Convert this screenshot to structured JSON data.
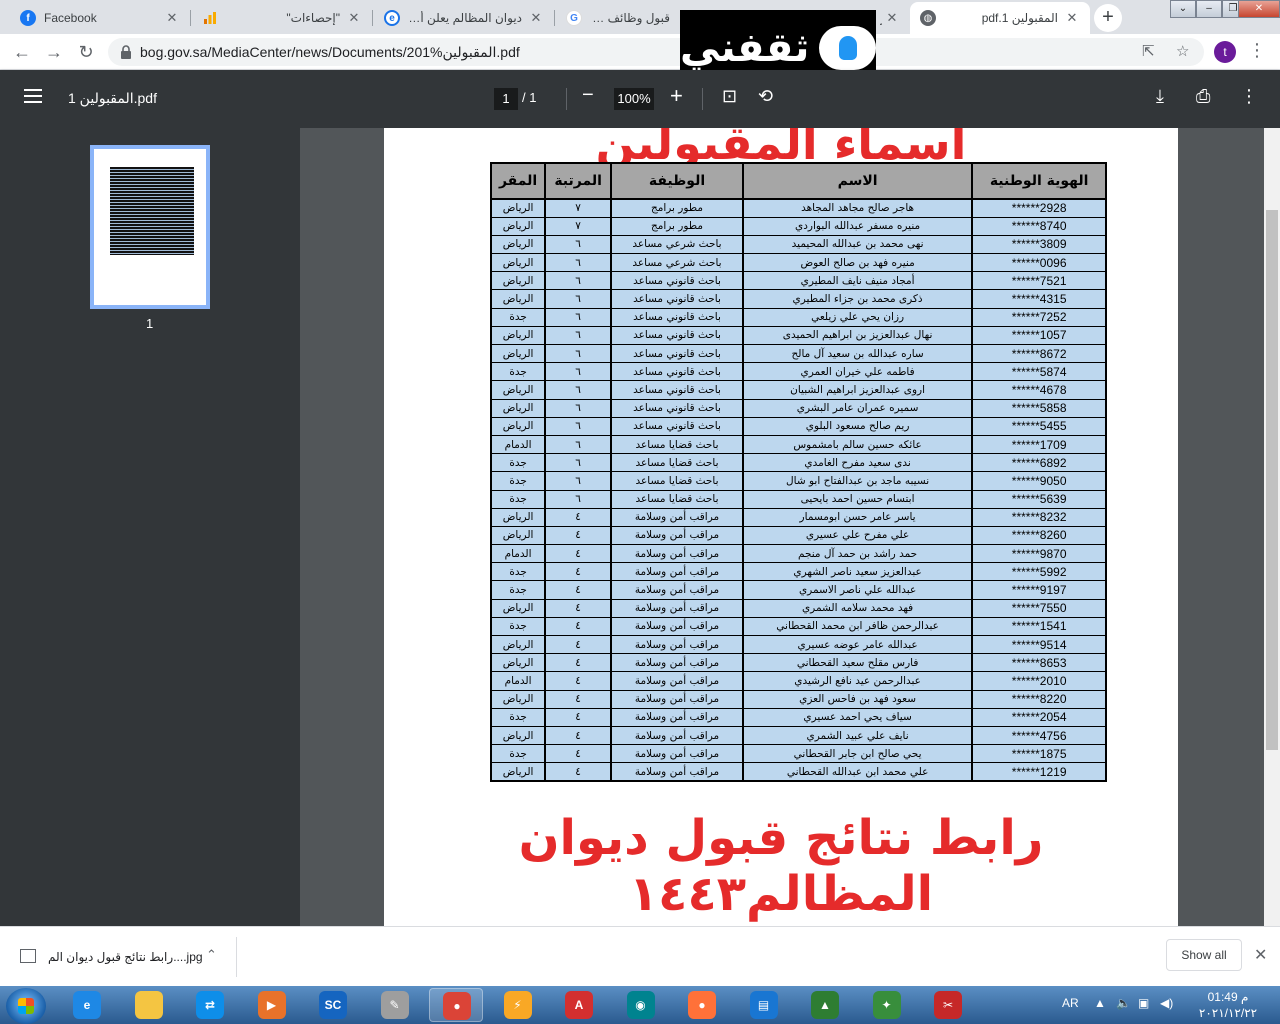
{
  "tabs": [
    {
      "title": "Facebook",
      "icon": "facebook-icon",
      "color": "#1877f2"
    },
    {
      "title": "\"إحصاءات\"",
      "icon": "analytics-icon",
      "color": "#f9ab00"
    },
    {
      "title": "ديوان المظالم يعلن أسماء المقـ",
      "icon": "site-icon",
      "color": "#1a73e8"
    },
    {
      "title": "قبول وظائف ديوان المظ",
      "icon": "google-icon",
      "color": "#4285f4"
    },
    {
      "title": "ر",
      "icon": "site-icon",
      "color": "#9aa0a6"
    },
    {
      "title": "المقبولين 1.pdf",
      "icon": "globe-icon",
      "color": "#5f6368"
    }
  ],
  "omnibox": {
    "url": "bog.gov.sa/MediaCenter/news/Documents/201%المقبولين.pdf"
  },
  "profile_initial": "t",
  "logo_text": "ثقفني",
  "pdf": {
    "title": "المقبولين 1.pdf",
    "page_current": "1",
    "page_total": "/   1",
    "zoom": "100%",
    "thumb_label": "1"
  },
  "document": {
    "heading": "أسماء المقبولين",
    "footer": "رابط نتائج قبول ديوان المظالم١٤٤٣",
    "columns": [
      "الهوية الوطنية",
      "الاسم",
      "الوظيفة",
      "المرتبة",
      "المقر"
    ],
    "rows": [
      [
        "******2928",
        "هاجر صالح مجاهد المجاهد",
        "مطور برامج",
        "٧",
        "الرياض"
      ],
      [
        "******8740",
        "منيره مسفر عبدالله البواردي",
        "مطور برامج",
        "٧",
        "الرياض"
      ],
      [
        "******3809",
        "نهى محمد بن عبدالله المحيميد",
        "باحث شرعي مساعد",
        "٦",
        "الرياض"
      ],
      [
        "******0096",
        "منيره فهد بن صالح العوض",
        "باحث شرعي مساعد",
        "٦",
        "الرياض"
      ],
      [
        "******7521",
        "أمجاد منيف نايف المطيري",
        "باحث قانوني مساعد",
        "٦",
        "الرياض"
      ],
      [
        "******4315",
        "ذكرى محمد بن جزاء المطيري",
        "باحث قانوني مساعد",
        "٦",
        "الرياض"
      ],
      [
        "******7252",
        "رزان يحي علي زيلعي",
        "باحث قانوني مساعد",
        "٦",
        "جدة"
      ],
      [
        "******1057",
        "نهال عبدالعزيز بن ابراهيم الحميدى",
        "باحث قانوني مساعد",
        "٦",
        "الرياض"
      ],
      [
        "******8672",
        "ساره عبدالله بن سعيد آل مالح",
        "باحث قانوني مساعد",
        "٦",
        "الرياض"
      ],
      [
        "******5874",
        "فاطمه علي خيران العمري",
        "باحث قانوني مساعد",
        "٦",
        "جدة"
      ],
      [
        "******4678",
        "اروى عبدالعزيز ابراهيم الشبيان",
        "باحث قانوني مساعد",
        "٦",
        "الرياض"
      ],
      [
        "******5858",
        "سميره عمران عامر البشري",
        "باحث قانوني مساعد",
        "٦",
        "الرياض"
      ],
      [
        "******5455",
        "ريم صالح مسعود البلوي",
        "باحث قانوني مساعد",
        "٦",
        "الرياض"
      ],
      [
        "******1709",
        "عائكه حسين سالم بامشموس",
        "باحث قضايا مساعد",
        "٦",
        "الدمام"
      ],
      [
        "******6892",
        "ندى سعيد مفرح الغامدي",
        "باحث قضايا مساعد",
        "٦",
        "جدة"
      ],
      [
        "******9050",
        "نسيبه ماجد بن عبدالفتاح ابو شال",
        "باحث قضايا مساعد",
        "٦",
        "جدة"
      ],
      [
        "******5639",
        "ابتسام حسين احمد بايحيى",
        "باحث قضايا مساعد",
        "٦",
        "جدة"
      ],
      [
        "******8232",
        "ياسر عامر حسن ابومسمار",
        "مراقب أمن وسلامة",
        "٤",
        "الرياض"
      ],
      [
        "******8260",
        "علي مفرح علي عسيري",
        "مراقب أمن وسلامة",
        "٤",
        "الرياض"
      ],
      [
        "******9870",
        "حمد راشد بن حمد آل منجم",
        "مراقب أمن وسلامة",
        "٤",
        "الدمام"
      ],
      [
        "******5992",
        "عبدالعزيز سعيد ناصر الشهري",
        "مراقب أمن وسلامة",
        "٤",
        "جدة"
      ],
      [
        "******9197",
        "عبدالله علي ناصر الاسمري",
        "مراقب أمن وسلامة",
        "٤",
        "جدة"
      ],
      [
        "******7550",
        "فهد محمد سلامه الشمري",
        "مراقب أمن وسلامة",
        "٤",
        "الرياض"
      ],
      [
        "******1541",
        "عبدالرحمن ظافر ابن محمد القحطاني",
        "مراقب أمن وسلامة",
        "٤",
        "جدة"
      ],
      [
        "******9514",
        "عبدالله عامر عوضه عسيري",
        "مراقب أمن وسلامة",
        "٤",
        "الرياض"
      ],
      [
        "******8653",
        "فارس مقلح سعيد القحطاني",
        "مراقب أمن وسلامة",
        "٤",
        "الرياض"
      ],
      [
        "******2010",
        "عبدالرحمن عيد نافع الرشيدي",
        "مراقب أمن وسلامة",
        "٤",
        "الدمام"
      ],
      [
        "******8220",
        "سعود فهد بن فاحس العزي",
        "مراقب أمن وسلامة",
        "٤",
        "الرياض"
      ],
      [
        "******2054",
        "سياف يحي احمد عسيري",
        "مراقب أمن وسلامة",
        "٤",
        "جدة"
      ],
      [
        "******4756",
        "نايف علي عبيد الشمري",
        "مراقب أمن وسلامة",
        "٤",
        "الرياض"
      ],
      [
        "******1875",
        "يحي صالح ابن جابر القحطاني",
        "مراقب أمن وسلامة",
        "٤",
        "جدة"
      ],
      [
        "******1219",
        "علي محمد ابن عبدالله القحطاني",
        "مراقب أمن وسلامة",
        "٤",
        "الرياض"
      ]
    ]
  },
  "download": {
    "filename": "رابط نتائج قبول ديوان الم....jpg",
    "show_all": "Show all"
  },
  "taskbar": {
    "apps": [
      {
        "name": "ie-icon",
        "color": "#1e88e5",
        "label": "e"
      },
      {
        "name": "file-explorer-icon",
        "color": "#f4c542",
        "label": ""
      },
      {
        "name": "teamviewer-icon",
        "color": "#0e8ee9",
        "label": "⇄"
      },
      {
        "name": "media-player-icon",
        "color": "#e8722a",
        "label": "▶"
      },
      {
        "name": "sc-app-icon",
        "color": "#1565c0",
        "label": "SC"
      },
      {
        "name": "notepad-icon",
        "color": "#9e9e9e",
        "label": "✎"
      },
      {
        "name": "chrome-icon",
        "color": "#db4437",
        "label": "●"
      },
      {
        "name": "flash-icon",
        "color": "#f9a825",
        "label": "⚡"
      },
      {
        "name": "acrobat-icon",
        "color": "#d32f2f",
        "label": "A"
      },
      {
        "name": "film-icon",
        "color": "#00838f",
        "label": "◉"
      },
      {
        "name": "firefox-icon",
        "color": "#ff7139",
        "label": "●"
      },
      {
        "name": "book-icon",
        "color": "#1976d2",
        "label": "▤"
      },
      {
        "name": "green-triangle-icon",
        "color": "#2e7d32",
        "label": "▲"
      },
      {
        "name": "network-icon",
        "color": "#388e3c",
        "label": "✦"
      },
      {
        "name": "tools-icon",
        "color": "#c62828",
        "label": "✂"
      }
    ],
    "lang": "AR",
    "time": "01:49 م",
    "date": "٢٠٢١/١٢/٢٢"
  }
}
